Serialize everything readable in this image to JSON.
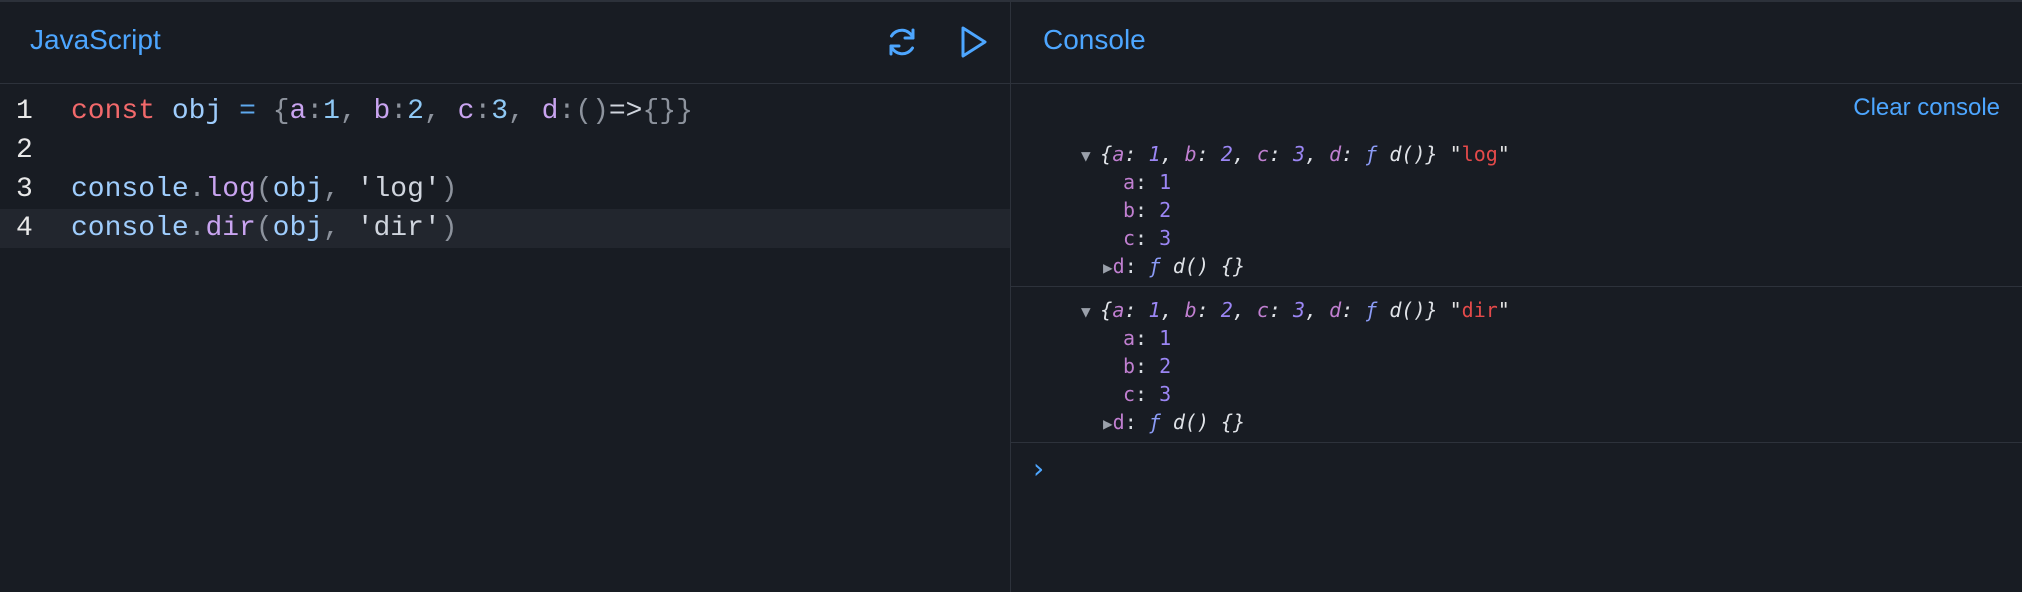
{
  "editor": {
    "title": "JavaScript",
    "lines": [
      {
        "number": "1",
        "tokens": [
          {
            "t": "const",
            "c": "kw"
          },
          {
            "t": " ",
            "c": "var"
          },
          {
            "t": "obj",
            "c": "var"
          },
          {
            "t": " ",
            "c": "var"
          },
          {
            "t": "=",
            "c": "op"
          },
          {
            "t": " ",
            "c": "var"
          },
          {
            "t": "{",
            "c": "punc"
          },
          {
            "t": "a",
            "c": "prop"
          },
          {
            "t": ":",
            "c": "punc"
          },
          {
            "t": "1",
            "c": "num"
          },
          {
            "t": ", ",
            "c": "punc"
          },
          {
            "t": "b",
            "c": "prop"
          },
          {
            "t": ":",
            "c": "punc"
          },
          {
            "t": "2",
            "c": "num"
          },
          {
            "t": ", ",
            "c": "punc"
          },
          {
            "t": "c",
            "c": "prop"
          },
          {
            "t": ":",
            "c": "punc"
          },
          {
            "t": "3",
            "c": "num"
          },
          {
            "t": ", ",
            "c": "punc"
          },
          {
            "t": "d",
            "c": "prop"
          },
          {
            "t": ":",
            "c": "punc"
          },
          {
            "t": "()",
            "c": "punc"
          },
          {
            "t": "=>",
            "c": "arrow"
          },
          {
            "t": "{}}",
            "c": "punc"
          }
        ]
      },
      {
        "number": "2",
        "tokens": []
      },
      {
        "number": "3",
        "tokens": [
          {
            "t": "console",
            "c": "ident"
          },
          {
            "t": ".",
            "c": "punc"
          },
          {
            "t": "log",
            "c": "meth"
          },
          {
            "t": "(",
            "c": "punc"
          },
          {
            "t": "obj",
            "c": "ident"
          },
          {
            "t": ", ",
            "c": "punc"
          },
          {
            "t": "'log'",
            "c": "str"
          },
          {
            "t": ")",
            "c": "punc"
          }
        ]
      },
      {
        "number": "4",
        "tokens": [
          {
            "t": "console",
            "c": "ident"
          },
          {
            "t": ".",
            "c": "punc"
          },
          {
            "t": "dir",
            "c": "meth"
          },
          {
            "t": "(",
            "c": "punc"
          },
          {
            "t": "obj",
            "c": "ident"
          },
          {
            "t": ", ",
            "c": "punc"
          },
          {
            "t": "'dir'",
            "c": "str"
          },
          {
            "t": ")",
            "c": "punc"
          }
        ]
      }
    ],
    "active_line": 4,
    "refresh_icon": "refresh-icon",
    "run_icon": "play-icon"
  },
  "console": {
    "title": "Console",
    "clear_label": "Clear console",
    "entries": [
      {
        "summary": [
          {
            "t": "{",
            "c": "s-plain"
          },
          {
            "t": "a",
            "c": "s-key"
          },
          {
            "t": ": ",
            "c": "s-plain"
          },
          {
            "t": "1",
            "c": "s-num"
          },
          {
            "t": ", ",
            "c": "s-plain"
          },
          {
            "t": "b",
            "c": "s-key"
          },
          {
            "t": ": ",
            "c": "s-plain"
          },
          {
            "t": "2",
            "c": "s-num"
          },
          {
            "t": ", ",
            "c": "s-plain"
          },
          {
            "t": "c",
            "c": "s-key"
          },
          {
            "t": ": ",
            "c": "s-plain"
          },
          {
            "t": "3",
            "c": "s-num"
          },
          {
            "t": ", ",
            "c": "s-plain"
          },
          {
            "t": "d",
            "c": "s-key"
          },
          {
            "t": ": ",
            "c": "s-plain"
          },
          {
            "t": "ƒ",
            "c": "s-f"
          },
          {
            "t": " d()}",
            "c": "s-plain"
          }
        ],
        "label": "log",
        "props": [
          {
            "key": "a",
            "value": "1"
          },
          {
            "key": "b",
            "value": "2"
          },
          {
            "key": "c",
            "value": "3"
          }
        ],
        "fn": {
          "key": "d",
          "f": "ƒ",
          "sig": "d() {}"
        }
      },
      {
        "summary": [
          {
            "t": "{",
            "c": "s-plain"
          },
          {
            "t": "a",
            "c": "s-key"
          },
          {
            "t": ": ",
            "c": "s-plain"
          },
          {
            "t": "1",
            "c": "s-num"
          },
          {
            "t": ", ",
            "c": "s-plain"
          },
          {
            "t": "b",
            "c": "s-key"
          },
          {
            "t": ": ",
            "c": "s-plain"
          },
          {
            "t": "2",
            "c": "s-num"
          },
          {
            "t": ", ",
            "c": "s-plain"
          },
          {
            "t": "c",
            "c": "s-key"
          },
          {
            "t": ": ",
            "c": "s-plain"
          },
          {
            "t": "3",
            "c": "s-num"
          },
          {
            "t": ", ",
            "c": "s-plain"
          },
          {
            "t": "d",
            "c": "s-key"
          },
          {
            "t": ": ",
            "c": "s-plain"
          },
          {
            "t": "ƒ",
            "c": "s-f"
          },
          {
            "t": " d()}",
            "c": "s-plain"
          }
        ],
        "label": "dir",
        "props": [
          {
            "key": "a",
            "value": "1"
          },
          {
            "key": "b",
            "value": "2"
          },
          {
            "key": "c",
            "value": "3"
          }
        ],
        "fn": {
          "key": "d",
          "f": "ƒ",
          "sig": "d() {}"
        }
      }
    ],
    "prompt_symbol": "›"
  },
  "colors": {
    "accent": "#4da6ff",
    "background": "#181c23",
    "keyword": "#f2696b",
    "string_red": "#e44a4a"
  }
}
